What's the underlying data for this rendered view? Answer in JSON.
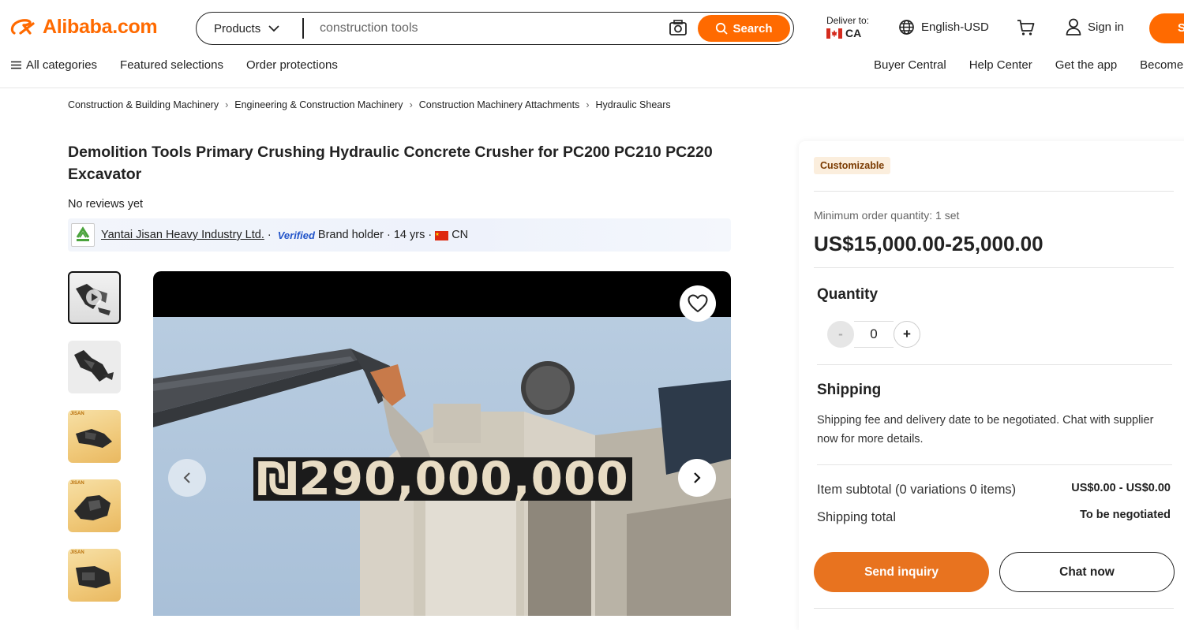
{
  "header": {
    "logo_text": "Alibaba.com",
    "products_label": "Products",
    "search_value": "construction tools",
    "search_button": "Search",
    "deliver_label": "Deliver to:",
    "deliver_country": "CA",
    "language": "English-USD",
    "signin": "Sign in",
    "signup_partial": "S",
    "brand_color": "#ff6a00"
  },
  "nav": {
    "left": [
      "All categories",
      "Featured selections",
      "Order protections"
    ],
    "right": [
      "Buyer Central",
      "Help Center",
      "Get the app",
      "Become"
    ]
  },
  "breadcrumb": [
    "Construction & Building Machinery",
    "Engineering & Construction Machinery",
    "Construction Machinery Attachments",
    "Hydraulic Shears"
  ],
  "product": {
    "title": "Demolition Tools Primary Crushing Hydraulic Concrete Crusher for PC200 PC210 PC220 Excavator",
    "reviews": "No reviews yet",
    "supplier_name": "Yantai Jisan Heavy Industry Ltd.",
    "verified": "Verified",
    "supplier_meta_1": "Brand holder · 14 yrs ·",
    "supplier_country": "CN",
    "video_overlay_text": "₪290,000,000"
  },
  "gallery": {
    "thumbnails": [
      "thumb-1",
      "thumb-2",
      "thumb-3",
      "thumb-4",
      "thumb-5"
    ],
    "thumb_tag": "JISAN"
  },
  "panel": {
    "badge": "Customizable",
    "moq": "Minimum order quantity: 1 set",
    "price": "US$15,000.00-25,000.00",
    "quantity_title": "Quantity",
    "quantity_value": "0",
    "minus": "-",
    "plus": "+",
    "shipping_title": "Shipping",
    "shipping_text": "Shipping fee and delivery date to be negotiated. Chat with supplier now for more details.",
    "subtotal_label": "Item subtotal (0 variations 0 items)",
    "subtotal_value": "US$0.00 - US$0.00",
    "shipping_total_label": "Shipping total",
    "shipping_total_value": "To be negotiated",
    "inquiry_button": "Send inquiry",
    "chat_button": "Chat now"
  }
}
